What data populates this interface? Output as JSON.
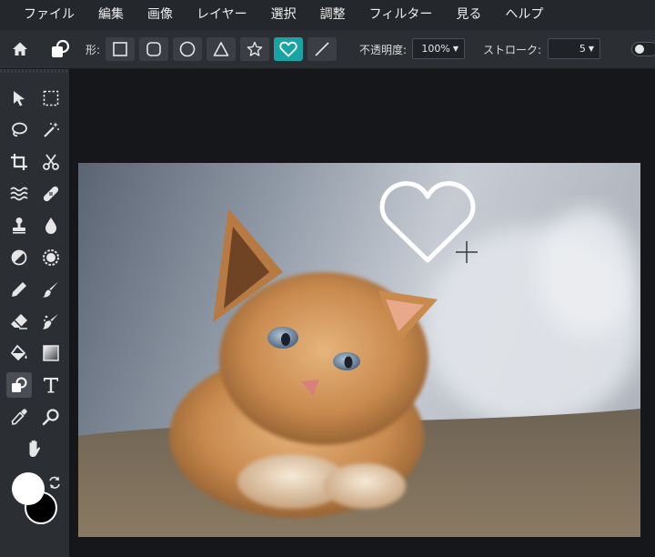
{
  "menu": [
    "ファイル",
    "編集",
    "画像",
    "レイヤー",
    "選択",
    "調整",
    "フィルター",
    "見る",
    "ヘルプ"
  ],
  "toolbar": {
    "shape_label": "形:",
    "shapes": [
      {
        "name": "rectangle-icon"
      },
      {
        "name": "rounded-rectangle-icon"
      },
      {
        "name": "circle-icon"
      },
      {
        "name": "triangle-icon"
      },
      {
        "name": "star-icon"
      },
      {
        "name": "heart-icon",
        "active": true
      },
      {
        "name": "line-icon"
      }
    ],
    "opacity_label": "不透明度:",
    "opacity_value": "100%",
    "stroke_label": "ストローク:",
    "stroke_value": "5"
  },
  "colors": {
    "accent": "#1aa3a3",
    "foreground": "#ffffff",
    "background": "#000000"
  },
  "sidebar": {
    "tools": [
      "move-icon",
      "marquee-icon",
      "lasso-icon",
      "magic-wand-icon",
      "crop-icon",
      "cut-icon",
      "liquify-icon",
      "heal-icon",
      "stamp-icon",
      "blur-icon",
      "dodge-icon",
      "sponge-icon",
      "pencil-icon",
      "brush-icon",
      "eraser-icon",
      "smudge-icon",
      "fill-bucket-icon",
      "gradient-icon",
      "shape-tool-icon",
      "text-icon",
      "eyedropper-icon",
      "zoom-icon",
      "hand-icon"
    ],
    "active_tool": "shape-tool-icon"
  }
}
